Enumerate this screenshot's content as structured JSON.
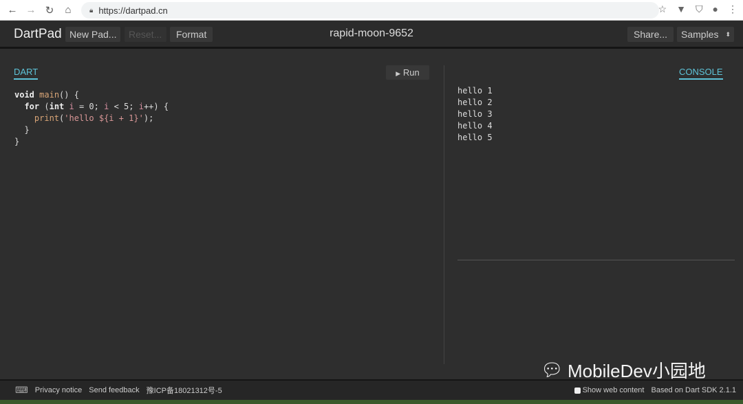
{
  "browser": {
    "url": "https://dartpad.cn",
    "icons": [
      "back-icon",
      "forward-icon",
      "reload-icon",
      "home-icon",
      "lock-icon",
      "star-icon",
      "extension-icon",
      "shield-icon",
      "account-icon",
      "menu-icon"
    ]
  },
  "header": {
    "logo": "DartPad",
    "new_pad": "New Pad...",
    "reset": "Reset...",
    "format": "Format",
    "title": "rapid-moon-9652",
    "share": "Share...",
    "samples": "Samples"
  },
  "editor": {
    "tab": "DART",
    "run": "Run",
    "code": [
      "void main() {",
      "  for (int i = 0; i < 5; i++) {",
      "    print('hello ${i + 1}');",
      "  }",
      "}"
    ]
  },
  "console": {
    "tab": "CONSOLE",
    "lines": [
      "hello 1",
      "hello 2",
      "hello 3",
      "hello 4",
      "hello 5"
    ]
  },
  "footer": {
    "privacy": "Privacy notice",
    "feedback": "Send feedback",
    "icp": "豫ICP备18021312号-5",
    "show_web": "Show web content",
    "sdk": "Based on Dart SDK 2.1.1"
  },
  "watermark": "MobileDev小园地",
  "colors": {
    "accent": "#5ec4d9",
    "background": "#2e2e2e"
  }
}
